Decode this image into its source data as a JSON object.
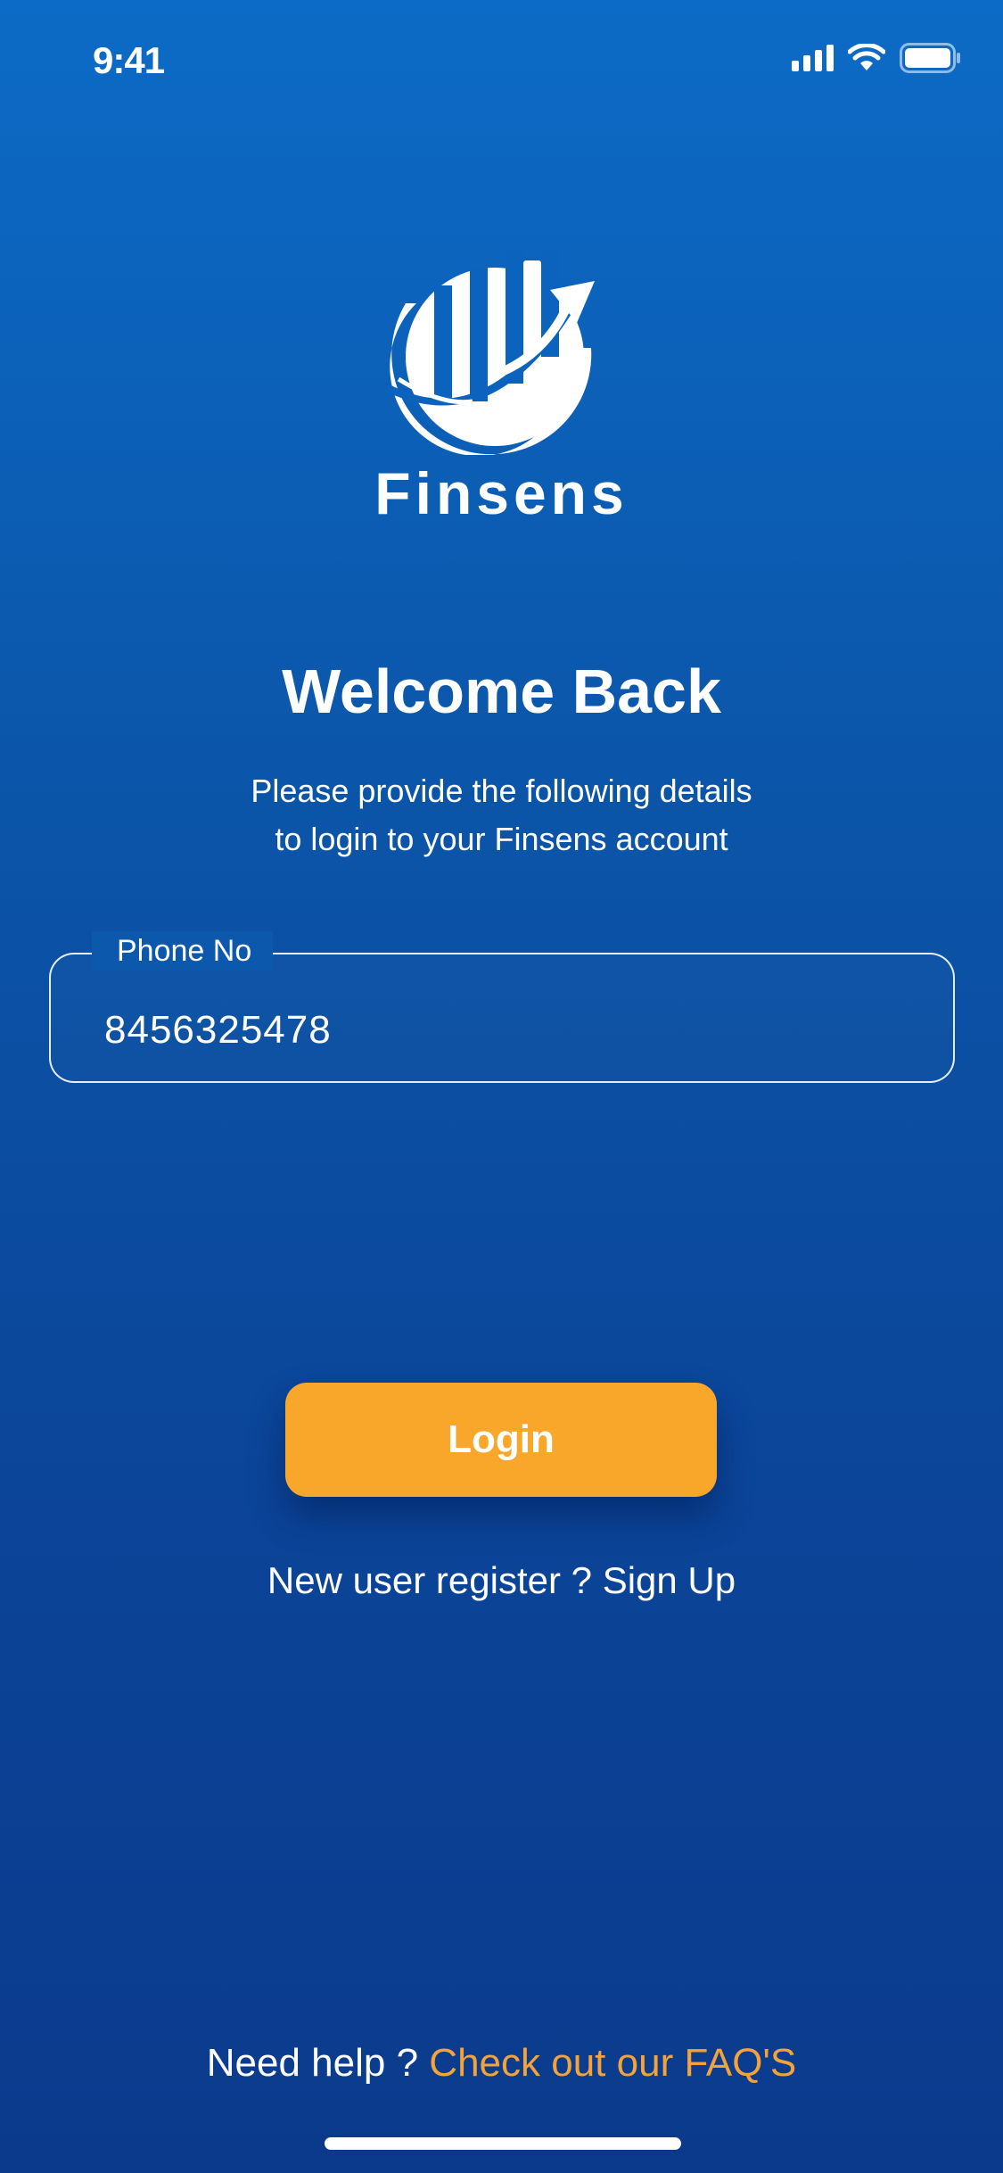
{
  "status_bar": {
    "time": "9:41",
    "icons": [
      "signal-icon",
      "wifi-icon",
      "battery-icon"
    ]
  },
  "brand": {
    "name": "Finsens",
    "logo": "finsens-logo"
  },
  "header": {
    "title": "Welcome Back",
    "subtitle_line1": "Please provide the following details",
    "subtitle_line2": "to login to your Finsens account"
  },
  "form": {
    "phone_label": "Phone No",
    "phone_value": "8456325478"
  },
  "actions": {
    "login_label": "Login",
    "register_prefix": "New user register ?",
    "register_link": "Sign Up"
  },
  "footer": {
    "help_prefix": "Need help ?",
    "faq_link": "Check out our FAQ'S"
  },
  "colors": {
    "background_top": "#0c6bc6",
    "background_bottom": "#0b3a8c",
    "button": "#f9a72b",
    "faq_link": "#f3a33a",
    "text": "#ffffff"
  }
}
